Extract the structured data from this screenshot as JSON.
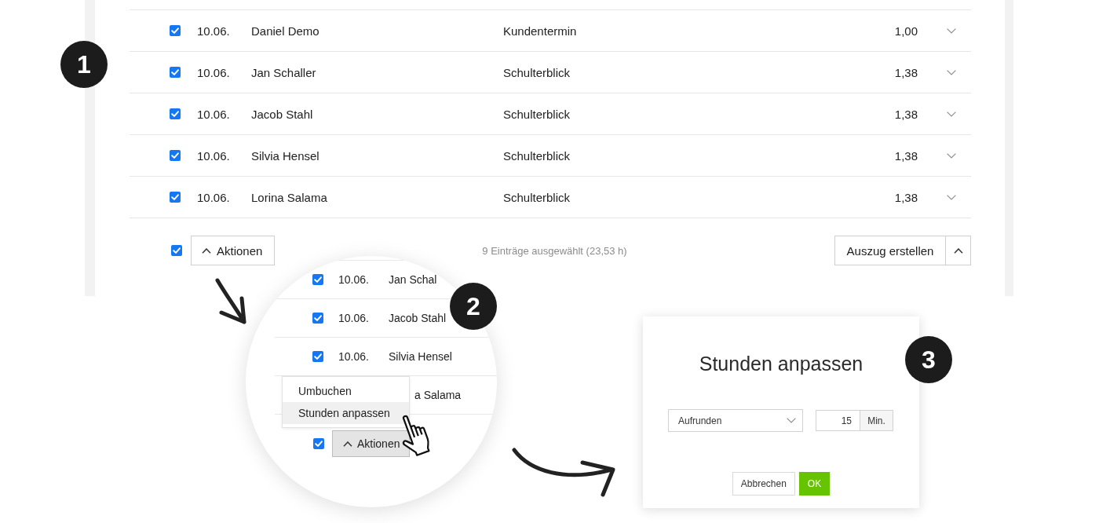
{
  "table": {
    "step": "1",
    "rows": [
      {
        "checked": true,
        "date": "10.06.",
        "name": "Daniel Demo",
        "type": "Kundentermin",
        "hours": "1,00"
      },
      {
        "checked": true,
        "date": "10.06.",
        "name": "Jan Schaller",
        "type": "Schulterblick",
        "hours": "1,38"
      },
      {
        "checked": true,
        "date": "10.06.",
        "name": "Jacob Stahl",
        "type": "Schulterblick",
        "hours": "1,38"
      },
      {
        "checked": true,
        "date": "10.06.",
        "name": "Silvia Hensel",
        "type": "Schulterblick",
        "hours": "1,38"
      },
      {
        "checked": true,
        "date": "10.06.",
        "name": "Lorina Salama",
        "type": "Schulterblick",
        "hours": "1,38"
      }
    ],
    "footer": {
      "checked": true,
      "actions_button": "Aktionen",
      "selection_summary": "9 Einträge ausgewählt (23,53 h)",
      "export_button": "Auszug erstellen"
    }
  },
  "magnifier": {
    "step": "2",
    "rows": [
      {
        "kind": "full",
        "checked": true,
        "date": "10.06.",
        "name": "Jan Schal"
      },
      {
        "kind": "full",
        "checked": true,
        "date": "10.06.",
        "name": "Jacob Stahl"
      },
      {
        "kind": "full",
        "checked": true,
        "date": "10.06.",
        "name": "Silvia Hensel"
      },
      {
        "kind": "covered",
        "name": "a Salama"
      }
    ],
    "menu": [
      {
        "label": "Umbuchen",
        "selected": false
      },
      {
        "label": "Stunden anpassen",
        "selected": true
      }
    ],
    "footer": {
      "checked": true,
      "actions_button": "Aktionen",
      "pressed": true
    }
  },
  "dialog": {
    "step": "3",
    "title": "Stunden anpassen",
    "mode_select": {
      "value": "Aufrunden"
    },
    "minutes_input": {
      "value": "15",
      "unit": "Min."
    },
    "buttons": [
      {
        "label": "Abbrechen",
        "kind": "secondary"
      },
      {
        "label": "OK",
        "kind": "primary"
      }
    ]
  }
}
